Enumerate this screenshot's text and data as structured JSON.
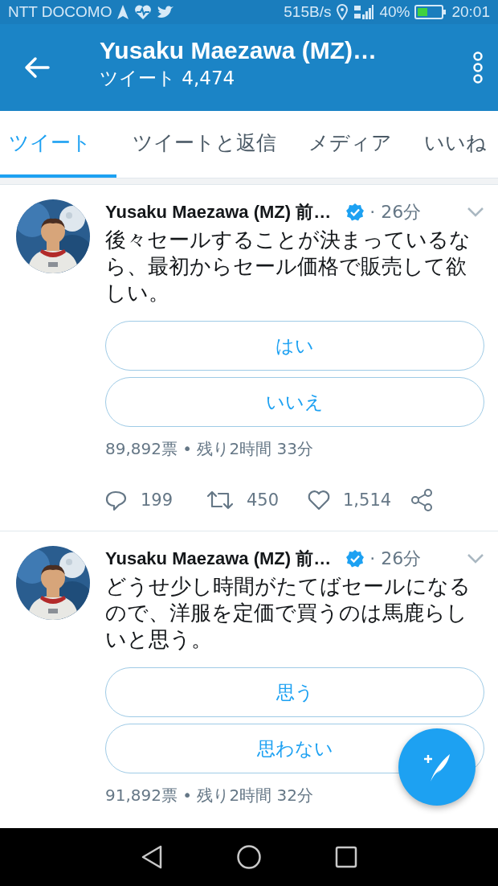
{
  "status_bar": {
    "carrier": "NTT DOCOMO",
    "speed": "515B/s",
    "battery": "40%",
    "time": "20:01"
  },
  "header": {
    "title": "Yusaku Maezawa (MZ)…",
    "subtitle": "ツイート 4,474"
  },
  "tabs": [
    {
      "label": "ツイート",
      "selected": true
    },
    {
      "label": "ツイートと返信",
      "selected": false
    },
    {
      "label": "メディア",
      "selected": false
    },
    {
      "label": "いいね",
      "selected": false
    }
  ],
  "tweets": [
    {
      "author": "Yusaku Maezawa (MZ) 前…",
      "verified": true,
      "time": "· 26分",
      "text": "後々セールすることが決まっているなら、最初からセール価格で販売して欲しい。",
      "poll": {
        "options": [
          "はい",
          "いいえ"
        ],
        "summary": "89,892票 • 残り2時間 33分"
      },
      "actions": {
        "replies": "199",
        "retweets": "450",
        "likes": "1,514"
      }
    },
    {
      "author": "Yusaku Maezawa (MZ) 前…",
      "verified": true,
      "time": "· 26分",
      "text": "どうせ少し時間がたてばセールになるので、洋服を定価で買うのは馬鹿らしいと思う。",
      "poll": {
        "options": [
          "思う",
          "思わない"
        ],
        "summary": "91,892票 • 残り2時間 32分"
      }
    }
  ]
}
